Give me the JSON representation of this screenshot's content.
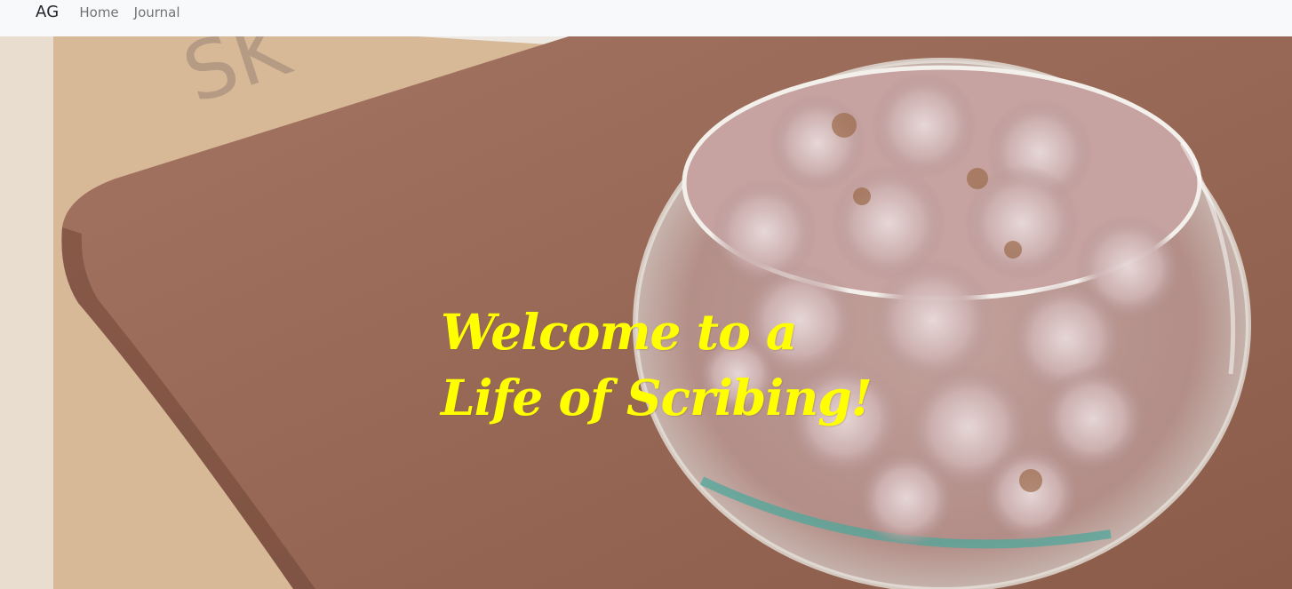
{
  "navbar": {
    "brand": "AG",
    "links": [
      "Home",
      "Journal"
    ]
  },
  "hero": {
    "heading_line1": "Welcome to a",
    "heading_line2": "Life of Scribing!",
    "heading_color": "#ffff00",
    "image": "dried-flowers-glass-bowl-on-book"
  }
}
